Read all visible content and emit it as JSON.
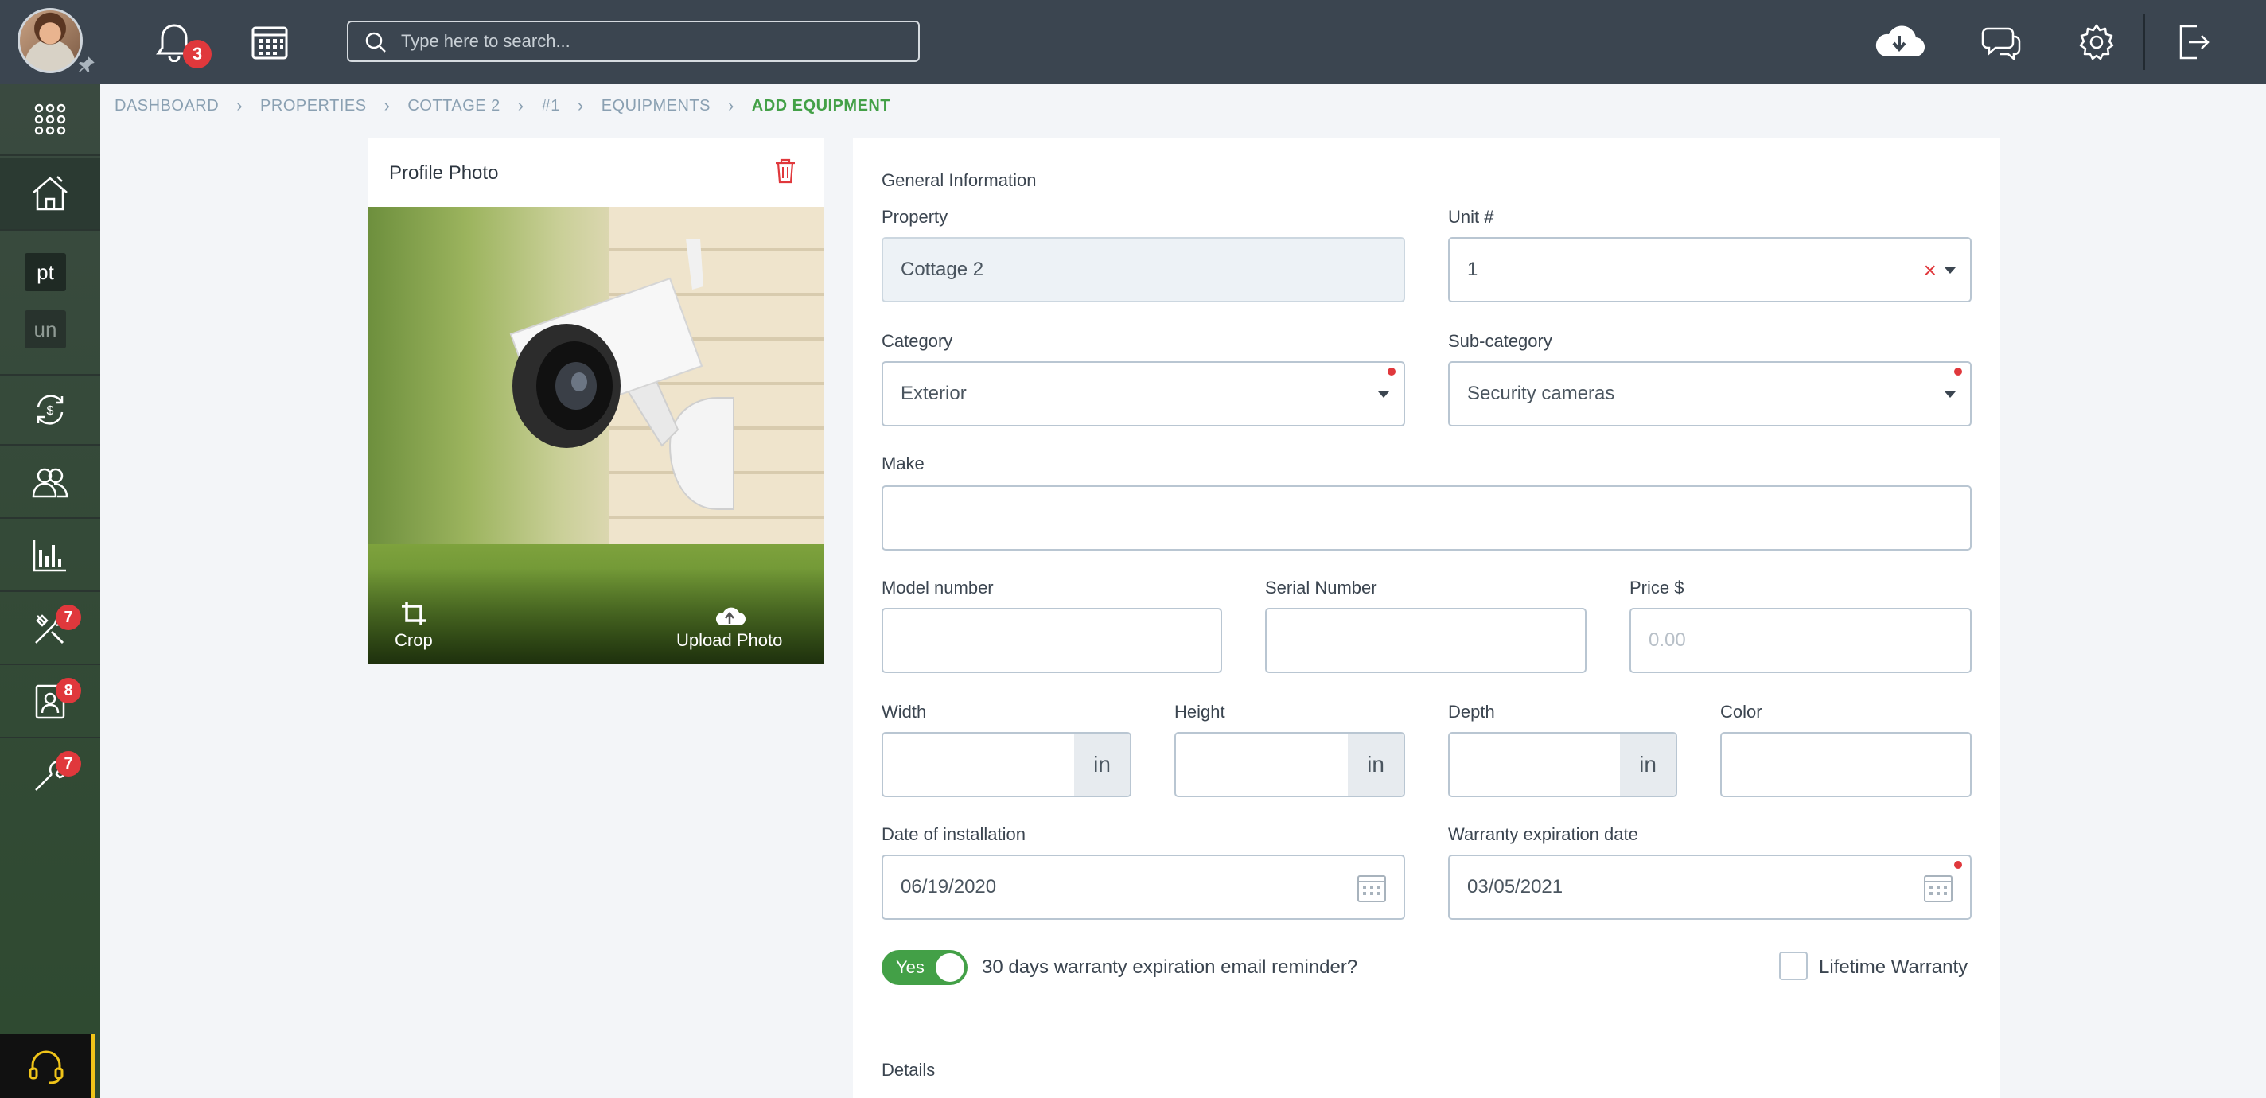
{
  "topbar": {
    "notification_count": "3",
    "search_placeholder": "Type here to search..."
  },
  "sidebar": {
    "tags": [
      "pt",
      "un"
    ],
    "badges": {
      "maintenance": "7",
      "tenants": "8",
      "tools": "7"
    }
  },
  "breadcrumb": [
    "DASHBOARD",
    "PROPERTIES",
    "COTTAGE 2",
    "#1",
    "EQUIPMENTS",
    "ADD EQUIPMENT"
  ],
  "photo_card": {
    "title": "Profile Photo",
    "crop_label": "Crop",
    "upload_label": "Upload Photo"
  },
  "form": {
    "general_title": "General Information",
    "property": {
      "label": "Property",
      "value": "Cottage 2"
    },
    "unit": {
      "label": "Unit #",
      "value": "1"
    },
    "category": {
      "label": "Category",
      "value": "Exterior"
    },
    "subcategory": {
      "label": "Sub-category",
      "value": "Security cameras"
    },
    "make": {
      "label": "Make",
      "value": ""
    },
    "model": {
      "label": "Model number",
      "value": ""
    },
    "serial": {
      "label": "Serial Number",
      "value": ""
    },
    "price": {
      "label": "Price $",
      "placeholder": "0.00"
    },
    "width": {
      "label": "Width",
      "unit": "in"
    },
    "height": {
      "label": "Height",
      "unit": "in"
    },
    "depth": {
      "label": "Depth",
      "unit": "in"
    },
    "color": {
      "label": "Color",
      "value": ""
    },
    "install_date": {
      "label": "Date of installation",
      "value": "06/19/2020"
    },
    "warranty_date": {
      "label": "Warranty expiration date",
      "value": "03/05/2021"
    },
    "reminder": {
      "toggle_label": "Yes",
      "text": "30 days warranty expiration email reminder?"
    },
    "lifetime_warranty": {
      "label": "Lifetime Warranty"
    },
    "details_title": "Details"
  },
  "colors": {
    "topbar": "#3b4550",
    "accent_green": "#43a047",
    "badge_red": "#e0383c"
  }
}
